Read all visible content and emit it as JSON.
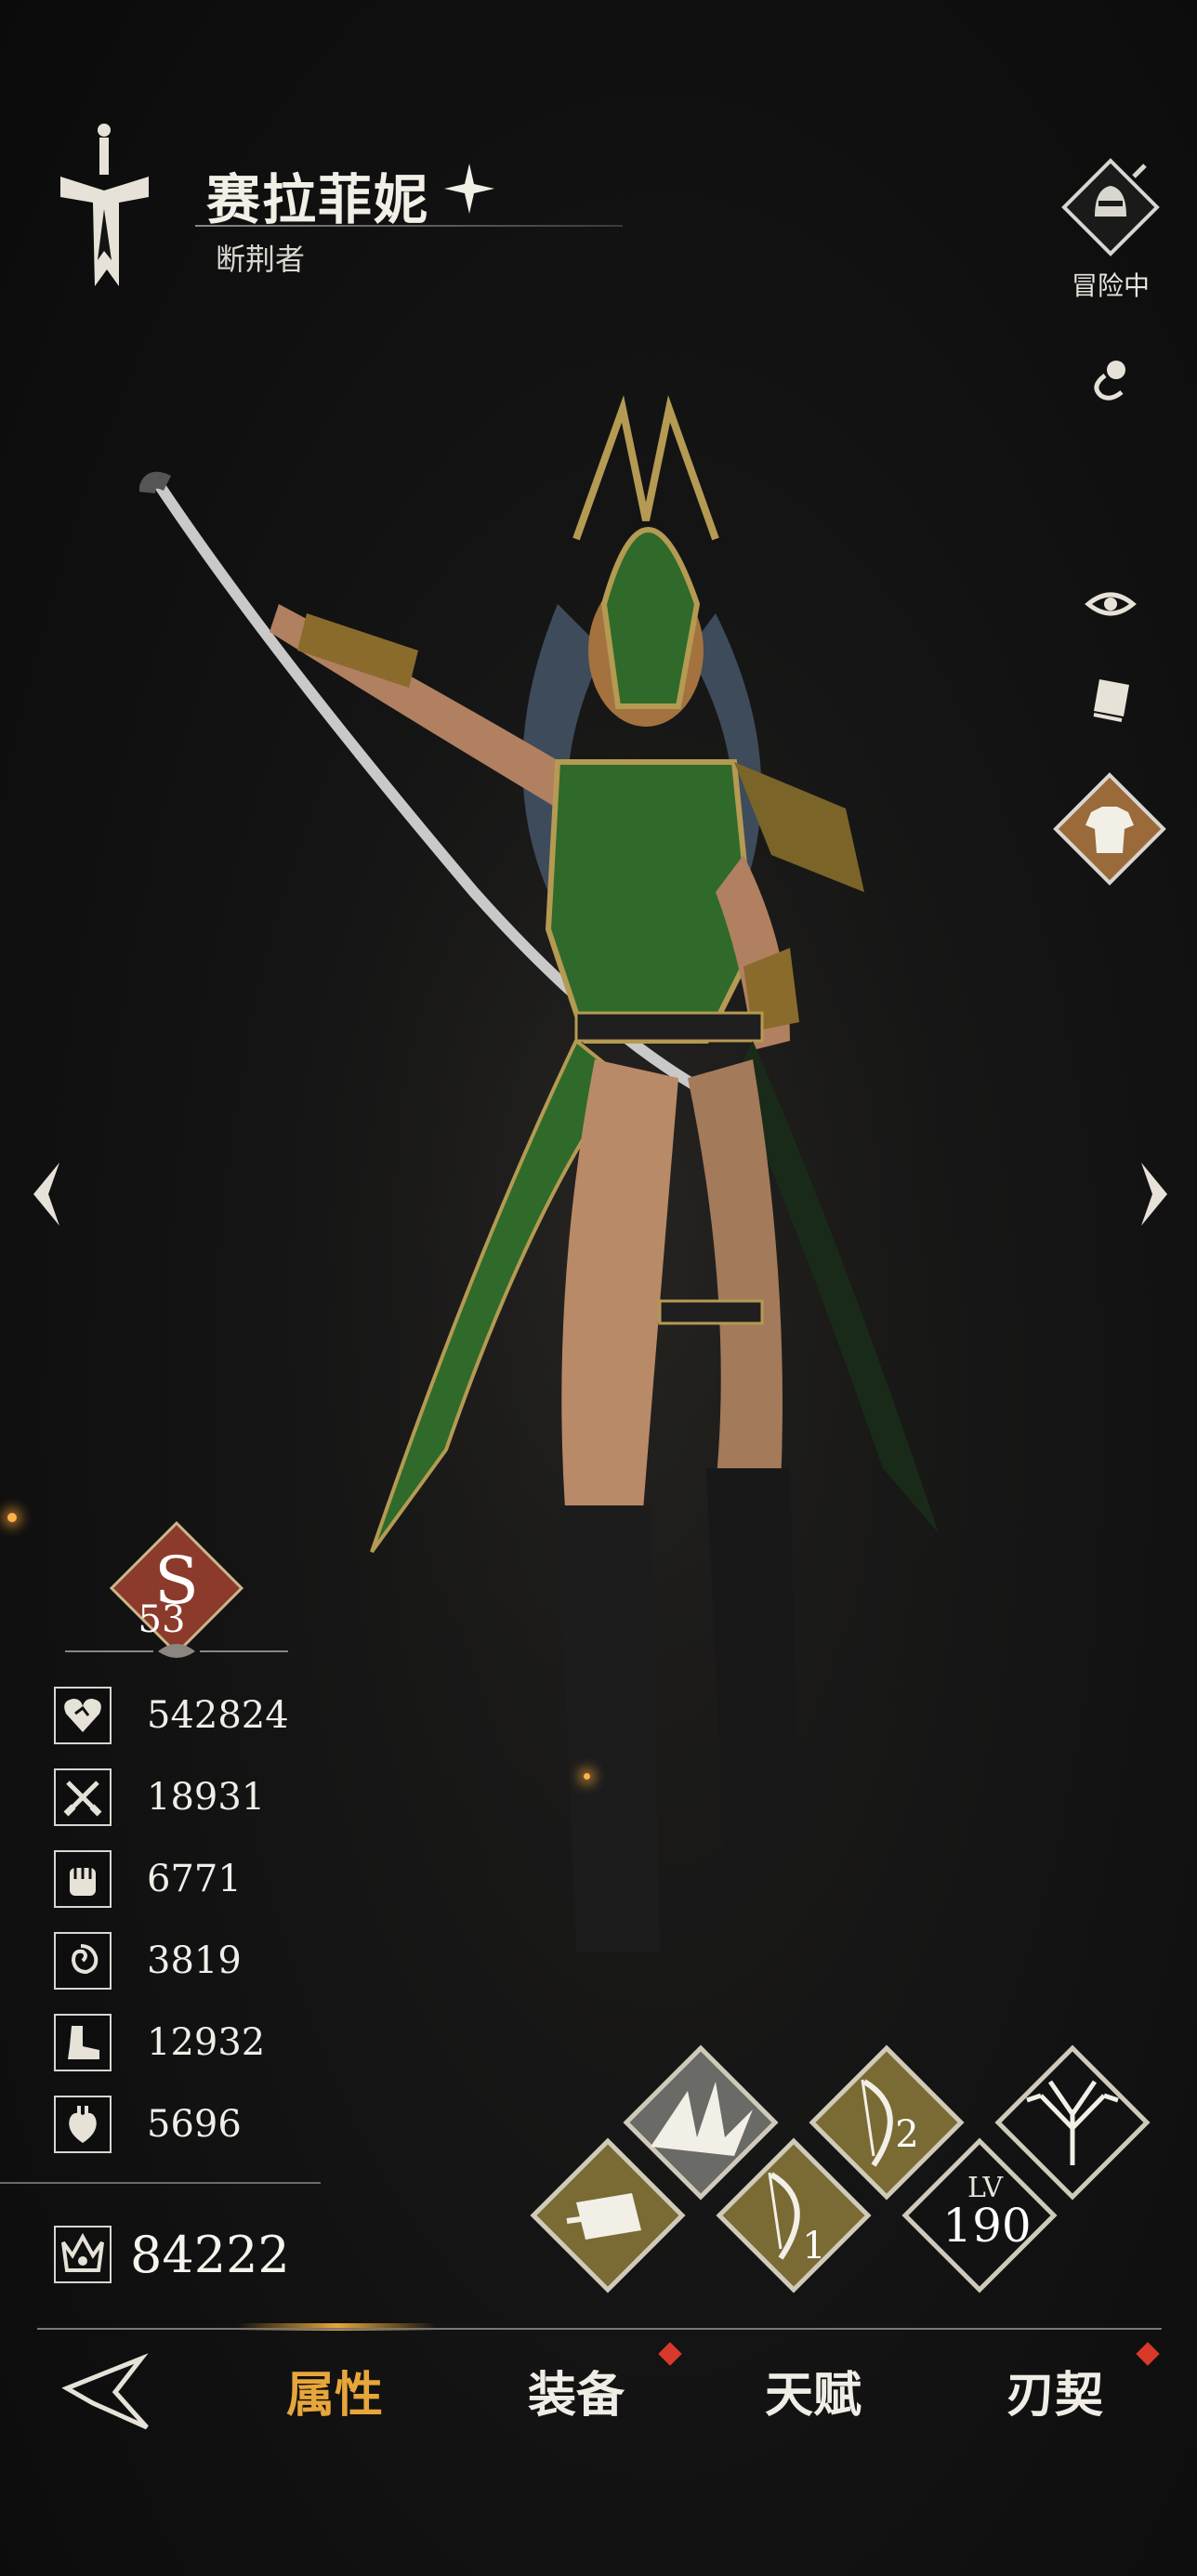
{
  "character": {
    "name": "赛拉菲妮",
    "title": "断荆者"
  },
  "status": {
    "label": "冒险中"
  },
  "rank": {
    "letter": "S",
    "level": "53"
  },
  "stats": [
    {
      "icon": "heart-icon",
      "value": "542824"
    },
    {
      "icon": "crossed-swords-icon",
      "value": "18931"
    },
    {
      "icon": "fist-icon",
      "value": "6771"
    },
    {
      "icon": "spiral-icon",
      "value": "3819"
    },
    {
      "icon": "boot-icon",
      "value": "12932"
    },
    {
      "icon": "anatomical-heart-icon",
      "value": "5696"
    }
  ],
  "power": {
    "icon": "crown-icon",
    "value": "84222"
  },
  "skills": {
    "skill_1_number": "1",
    "skill_2_number": "2",
    "lv_label": "LV",
    "lv_value": "190"
  },
  "nav": {
    "tabs": [
      {
        "label": "属性",
        "active": true
      },
      {
        "label": "装备",
        "active": false,
        "badge": true
      },
      {
        "label": "天赋",
        "active": false
      },
      {
        "label": "刃契",
        "active": false,
        "badge": true
      }
    ]
  },
  "colors": {
    "accent": "#e7a63a",
    "gold": "#b49a52",
    "rank_red": "#8c3a2c",
    "badge_red": "#d9392b",
    "outfit_green": "#2f6a2a"
  }
}
